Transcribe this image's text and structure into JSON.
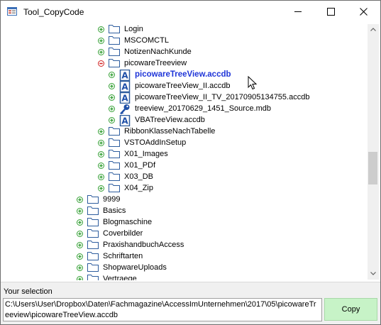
{
  "window": {
    "title": "Tool_CopyCode",
    "minimize_glyph": "minimize-icon",
    "maximize_glyph": "maximize-icon",
    "close_glyph": "close-icon"
  },
  "colors": {
    "folder_outline": "#2e5d9e",
    "plus_green": "#35a035",
    "minus_red": "#d22424",
    "selected_text": "#1f35d8",
    "copy_button_bg": "#c7f3c7",
    "panel_bg": "#f0f0f0"
  },
  "tree": {
    "rows": [
      {
        "label": "Login",
        "icon": "folder",
        "expander": "plus",
        "bold": false
      },
      {
        "label": "MSCOMCTL",
        "icon": "folder",
        "expander": "plus",
        "bold": false
      },
      {
        "label": "NotizenNachKunde",
        "icon": "folder",
        "expander": "plus",
        "bold": false
      },
      {
        "label": "picowareTreeview",
        "icon": "folder",
        "expander": "minus",
        "bold": false
      },
      {
        "label": "picowareTreeView.accdb",
        "icon": "access-file",
        "expander": "plus",
        "bold": true
      },
      {
        "label": "picowareTreeView_II.accdb",
        "icon": "access-file",
        "expander": "plus",
        "bold": false
      },
      {
        "label": "picowareTreeView_II_TV_20170905134755.accdb",
        "icon": "access-file",
        "expander": "plus",
        "bold": false
      },
      {
        "label": "treeview_20170629_1451_Source.mdb",
        "icon": "key-file",
        "expander": "plus",
        "bold": false
      },
      {
        "label": "VBATreeView.accdb",
        "icon": "access-file",
        "expander": "plus",
        "bold": false
      },
      {
        "label": "RibbonKlasseNachTabelle",
        "icon": "folder",
        "expander": "plus",
        "bold": false
      },
      {
        "label": "VSTOAddInSetup",
        "icon": "folder",
        "expander": "plus",
        "bold": false
      },
      {
        "label": "X01_Images",
        "icon": "folder",
        "expander": "plus",
        "bold": false
      },
      {
        "label": "X01_PDf",
        "icon": "folder",
        "expander": "plus",
        "bold": false
      },
      {
        "label": "X03_DB",
        "icon": "folder",
        "expander": "plus",
        "bold": false
      },
      {
        "label": "X04_Zip",
        "icon": "folder",
        "expander": "plus",
        "bold": false
      },
      {
        "label": "9999",
        "icon": "folder",
        "expander": "plus",
        "bold": false
      },
      {
        "label": "Basics",
        "icon": "folder",
        "expander": "plus",
        "bold": false
      },
      {
        "label": "Blogmaschine",
        "icon": "folder",
        "expander": "plus",
        "bold": false
      },
      {
        "label": "Coverbilder",
        "icon": "folder",
        "expander": "plus",
        "bold": false
      },
      {
        "label": "PraxishandbuchAccess",
        "icon": "folder",
        "expander": "plus",
        "bold": false
      },
      {
        "label": "Schriftarten",
        "icon": "folder",
        "expander": "plus",
        "bold": false
      },
      {
        "label": "ShopwareUploads",
        "icon": "folder",
        "expander": "plus",
        "bold": false
      },
      {
        "label": "Vertraege",
        "icon": "folder",
        "expander": "plus",
        "bold": false
      }
    ]
  },
  "selection": {
    "label": "Your selection",
    "path": "C:\\Users\\User\\Dropbox\\Daten\\Fachmagazine\\AccessImUnternehmen\\2017\\05\\picowareTreeview\\picowareTreeView.accdb",
    "copy_label": "Copy"
  }
}
